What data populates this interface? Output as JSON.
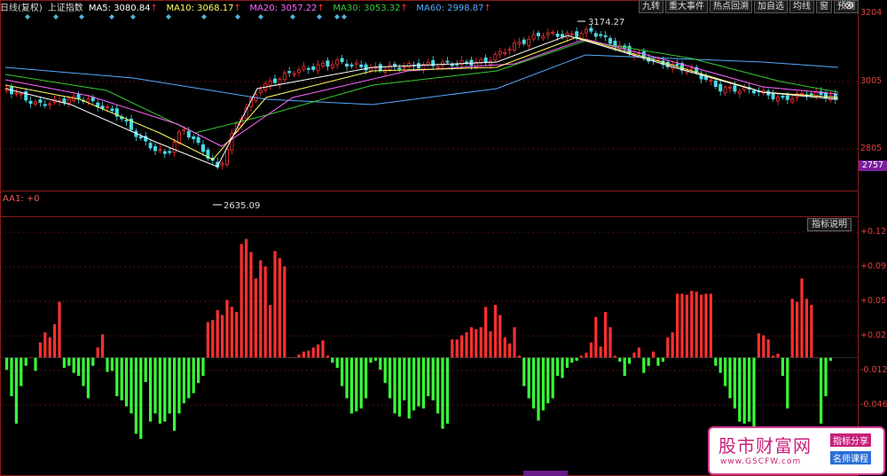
{
  "topbar": {
    "period": "日线(复权)",
    "index_name": "上证指数",
    "ma5": "MA5: 3080.84",
    "ma10": "MA10: 3068.17",
    "ma20": "MA20: 3057.22",
    "ma30": "MA30: 3053.32",
    "ma60": "MA60: 2998.87",
    "arrow": "↑"
  },
  "toolbar": [
    "九转",
    "重大事件",
    "热点回溯",
    "加自选",
    "均线",
    "窗",
    "预测"
  ],
  "window": {
    "close_glyph": "⊗"
  },
  "price_axis": [
    "3204",
    "3005",
    "2805"
  ],
  "current_price": "2757",
  "annotations": {
    "high": "3174.27",
    "low": "2635.09"
  },
  "indicator": {
    "title": "AA1: +0",
    "explain_button": "指标说明",
    "axis": [
      "+0.126",
      "+0.092",
      "+0.057",
      "+0.023",
      "-0.012",
      "-0.046"
    ]
  },
  "watermark": {
    "brand": "股市财富网",
    "url": "www.GSCFW.com",
    "tag1": "指标分享",
    "tag2": "名师课程"
  },
  "colors": {
    "up": "#ff3030",
    "down": "#39ff39",
    "ma5": "#ffffff",
    "ma10": "#ffff66",
    "ma20": "#ff66ff",
    "ma30": "#33cc33",
    "ma60": "#55aaff"
  },
  "chart_data": {
    "type": "bar",
    "indicator_values": [
      -0.012,
      -0.038,
      -0.065,
      -0.028,
      -0.008,
      0.0,
      -0.013,
      0.015,
      0.025,
      0.02,
      0.033,
      0.055,
      -0.01,
      -0.008,
      -0.015,
      -0.018,
      -0.028,
      -0.04,
      -0.008,
      0.01,
      0.023,
      -0.014,
      -0.013,
      -0.038,
      -0.042,
      -0.048,
      -0.055,
      -0.075,
      -0.08,
      -0.024,
      -0.063,
      -0.055,
      -0.065,
      -0.063,
      -0.055,
      -0.072,
      -0.055,
      -0.045,
      -0.04,
      -0.035,
      -0.025,
      -0.018,
      0.035,
      0.037,
      0.047,
      0.042,
      0.057,
      0.05,
      0.045,
      0.112,
      0.117,
      0.104,
      0.078,
      0.096,
      0.09,
      0.052,
      0.105,
      0.098,
      0.09,
      0.0,
      0.0,
      0.003,
      0.006,
      0.007,
      0.01,
      0.013,
      0.017,
      0.002,
      -0.005,
      -0.01,
      -0.028,
      -0.04,
      -0.055,
      -0.053,
      -0.05,
      -0.04,
      -0.005,
      -0.003,
      -0.012,
      -0.025,
      -0.04,
      -0.055,
      -0.058,
      -0.042,
      -0.06,
      -0.052,
      -0.048,
      -0.05,
      -0.038,
      -0.042,
      -0.055,
      -0.07,
      -0.065,
      0.018,
      0.018,
      0.022,
      0.025,
      0.03,
      0.028,
      0.03,
      0.05,
      0.026,
      0.052,
      0.042,
      0.02,
      0.014,
      0.03,
      0.002,
      -0.028,
      -0.04,
      -0.05,
      -0.062,
      -0.052,
      -0.045,
      -0.04,
      -0.018,
      -0.02,
      -0.01,
      -0.005,
      -0.003,
      0.002,
      0.005,
      0.015,
      0.04,
      0.011,
      0.045,
      0.03,
      0.002,
      -0.004,
      -0.018,
      -0.006,
      0.005,
      0.01,
      -0.015,
      -0.008,
      0.006,
      -0.008,
      -0.004,
      0.02,
      0.025,
      0.063,
      0.063,
      0.062,
      0.066,
      0.065,
      0.062,
      0.063,
      0.063,
      -0.008,
      -0.015,
      -0.028,
      -0.04,
      -0.05,
      -0.063,
      -0.065,
      -0.063,
      -0.07,
      0.024,
      0.022,
      0.018,
      0.002,
      0.004,
      -0.018,
      -0.05,
      0.058,
      0.055,
      0.078,
      0.058,
      0.052,
      0.0,
      -0.065,
      -0.038,
      -0.003
    ]
  }
}
